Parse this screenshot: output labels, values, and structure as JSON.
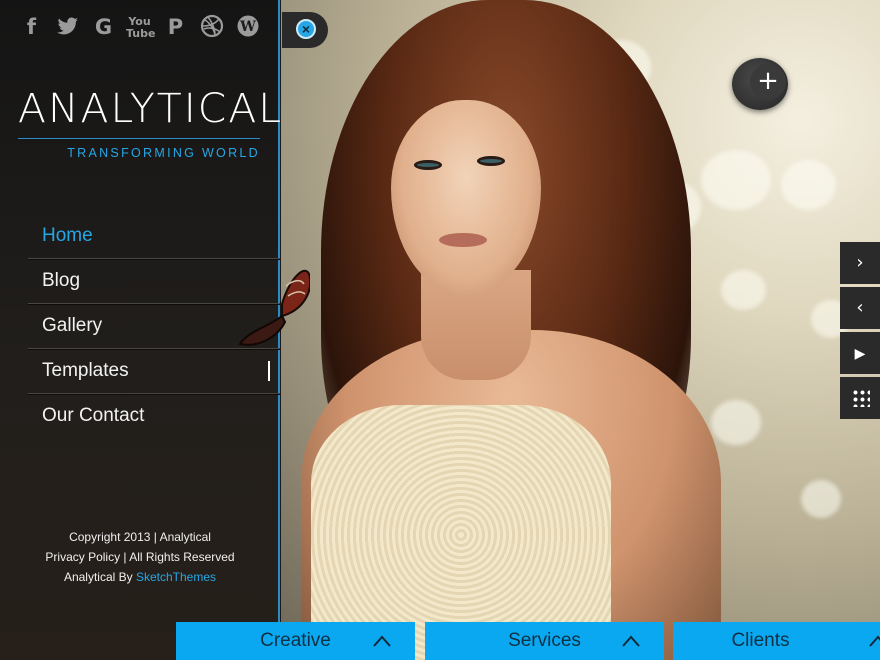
{
  "social": {
    "icons": [
      "facebook-icon",
      "twitter-icon",
      "google-icon",
      "youtube-icon",
      "pinterest-icon",
      "dribbble-icon",
      "wordpress-icon"
    ],
    "glyphs": [
      "f",
      "🐦",
      "G",
      "You\nTube",
      "P",
      "⊕",
      "W"
    ]
  },
  "logo": {
    "name": "ANALYTICAL",
    "tagline": "TRANSFORMING WORLD"
  },
  "nav": {
    "items": [
      {
        "label": "Home",
        "active": true
      },
      {
        "label": "Blog",
        "active": false
      },
      {
        "label": "Gallery",
        "active": false
      },
      {
        "label": "Templates",
        "active": false
      },
      {
        "label": "Our Contact",
        "active": false
      }
    ]
  },
  "footer": {
    "line1": "Copyright 2013 | Analytical",
    "line2": "Privacy Policy | All Rights Reserved",
    "line3_prefix": "Analytical By ",
    "line3_link": "SketchThemes"
  },
  "controls": {
    "close": "×",
    "plus": "+",
    "next": "›",
    "prev": "‹",
    "play": "▶"
  },
  "tabs": [
    {
      "label": "Creative"
    },
    {
      "label": "Services"
    },
    {
      "label": "Clients"
    }
  ],
  "colors": {
    "accent": "#27a6e6",
    "tab_bg": "#0aa8f0",
    "sidebar_border": "#2b8bc7"
  }
}
